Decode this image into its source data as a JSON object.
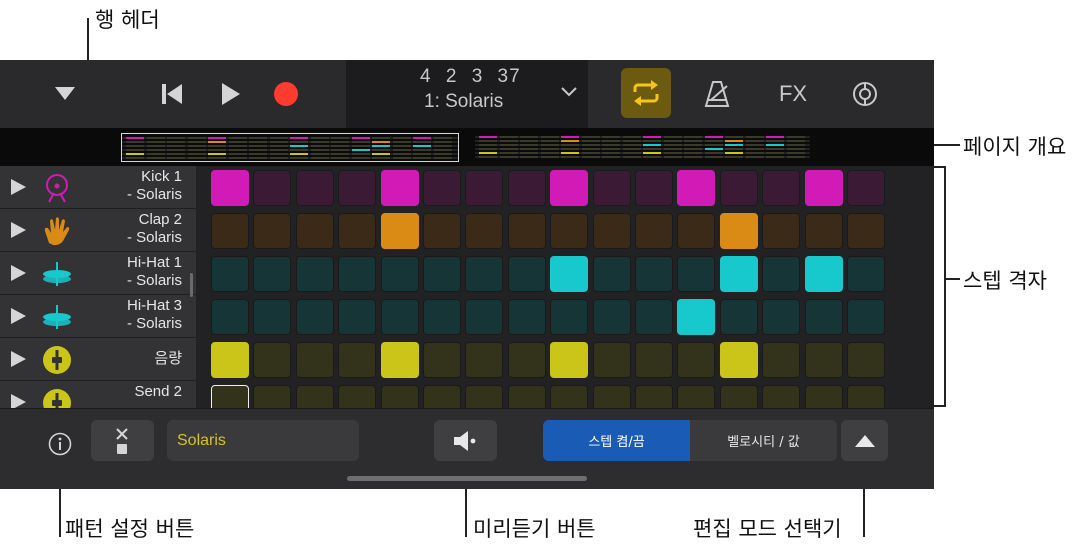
{
  "callouts": {
    "row_header": "행 헤더",
    "page_overview": "페이지 개요",
    "step_grid": "스텝 격자",
    "pattern_settings": "패턴 설정 버튼",
    "preview": "미리듣기 버튼",
    "edit_mode": "편집 모드 선택기"
  },
  "control_bar": {
    "position_readout": "4 2 3   37",
    "pattern_title": "1: Solaris",
    "fx_label": "FX",
    "cycle_active": true,
    "accent_color": "#f5c518",
    "record_color": "#ff3b30"
  },
  "rows": [
    {
      "name": "Kick 1\n- Solaris",
      "icon": "kick-drum-icon",
      "color": "#d11ab6",
      "dim": "#3a1a35",
      "steps": [
        1,
        0,
        0,
        0,
        1,
        0,
        0,
        0,
        1,
        0,
        0,
        1,
        0,
        0,
        1,
        0
      ]
    },
    {
      "name": "Clap 2\n- Solaris",
      "icon": "clap-hand-icon",
      "color": "#d98b16",
      "dim": "#3a2a17",
      "steps": [
        0,
        0,
        0,
        0,
        1,
        0,
        0,
        0,
        0,
        0,
        0,
        0,
        1,
        0,
        0,
        0
      ]
    },
    {
      "name": "Hi-Hat 1\n- Solaris",
      "icon": "hi-hat-icon",
      "color": "#17c8cc",
      "dim": "#163536",
      "steps": [
        0,
        0,
        0,
        0,
        0,
        0,
        0,
        0,
        1,
        0,
        0,
        0,
        1,
        0,
        1,
        0
      ]
    },
    {
      "name": "Hi-Hat 3\n- Solaris",
      "icon": "hi-hat-icon",
      "color": "#17c8cc",
      "dim": "#163536",
      "steps": [
        0,
        0,
        0,
        0,
        0,
        0,
        0,
        0,
        0,
        0,
        0,
        1,
        0,
        0,
        0,
        0
      ]
    },
    {
      "name": "음량",
      "icon": "volume-knob-icon",
      "color": "#cbc51a",
      "dim": "#33321a",
      "steps": [
        1,
        0,
        0,
        0,
        1,
        0,
        0,
        0,
        1,
        0,
        0,
        0,
        1,
        0,
        0,
        0
      ]
    },
    {
      "name": "Send 2",
      "icon": "send-knob-icon",
      "color": "#cbc51a",
      "dim": "#33321a",
      "steps": [
        0,
        0,
        0,
        0,
        0,
        0,
        0,
        0,
        0,
        0,
        0,
        0,
        0,
        0,
        0,
        0
      ]
    }
  ],
  "bottom_bar": {
    "pattern_name": "Solaris",
    "mode_step": "스텝 켬/끔",
    "mode_velocity": "벨로시티 / 값"
  }
}
